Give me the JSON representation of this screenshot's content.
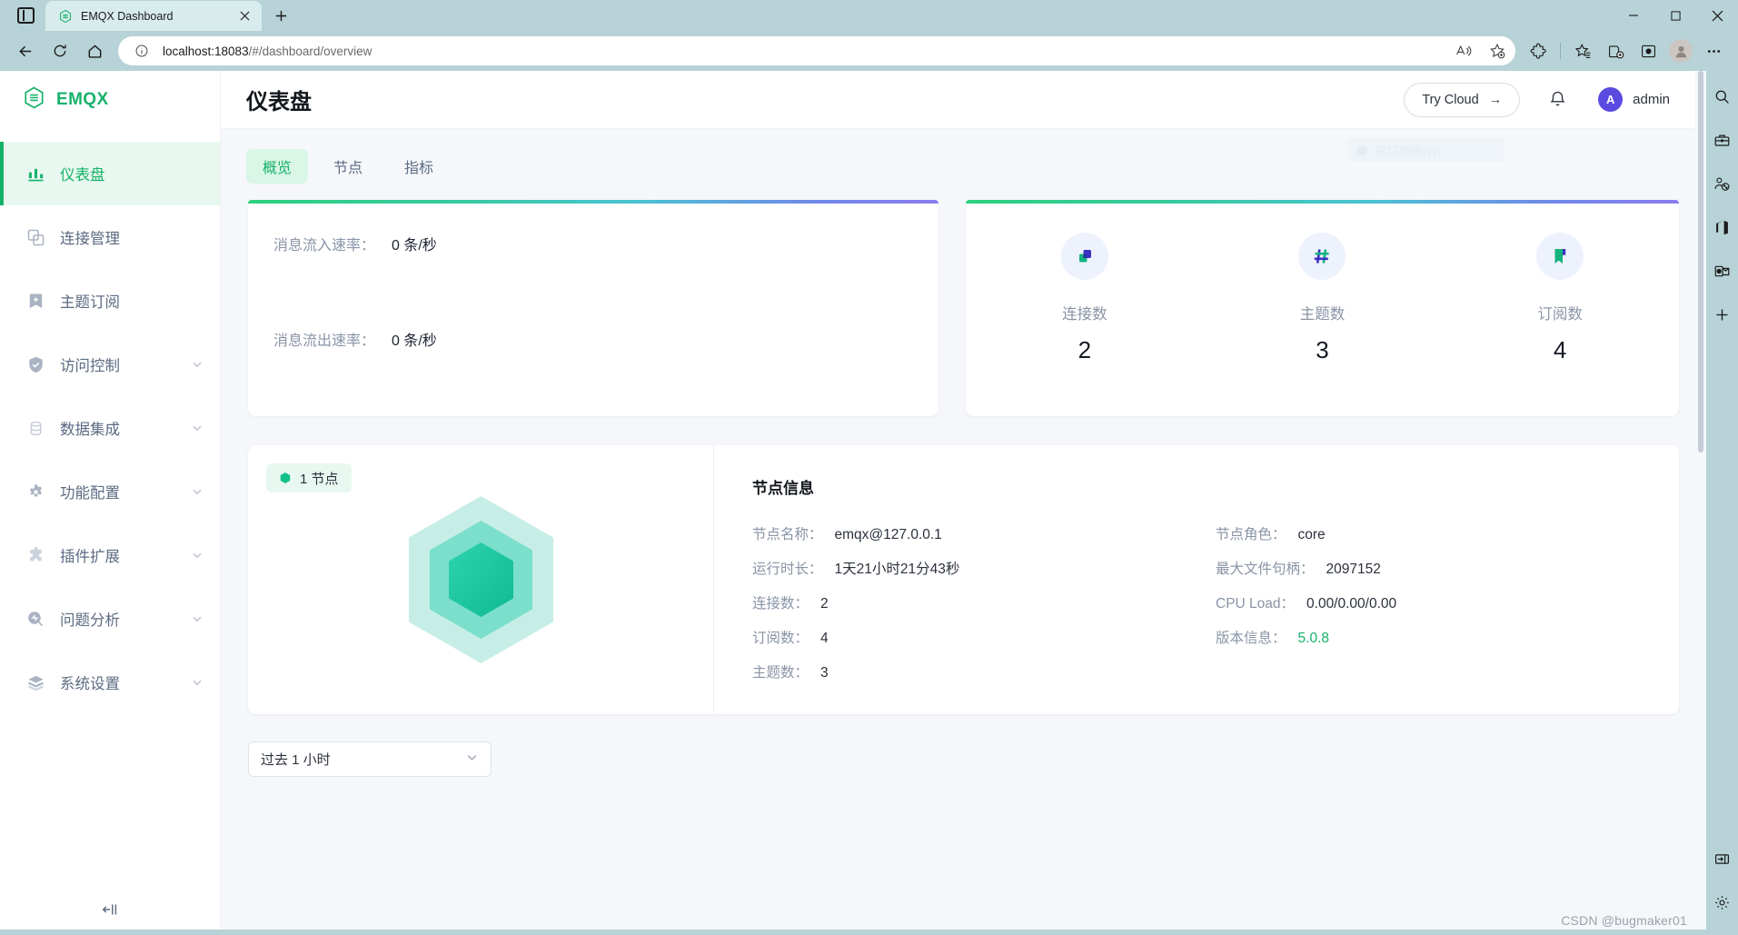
{
  "browser": {
    "tab": {
      "title": "EMQX Dashboard",
      "favicon_icon": "emqx-hexagon-icon",
      "close_icon": "close-icon"
    },
    "new_tab_icon": "plus-icon",
    "window_controls": {
      "minimize": "—",
      "maximize": "❐",
      "close": "✕"
    },
    "nav": {
      "back_icon": "arrow-left-icon",
      "reload_icon": "reload-icon",
      "home_icon": "home-icon"
    },
    "omnibox": {
      "info_icon": "info-circle-icon",
      "url_host": "localhost:18083",
      "url_path": "/#/dashboard/overview",
      "read_aloud_icon": "read-aloud-icon",
      "favorite_icon": "add-favorite-icon"
    },
    "toolbar_icons": [
      "extensions-icon",
      "favorites-icon",
      "collections-icon",
      "browser-essentials-icon",
      "profile-avatar-icon",
      "settings-more-icon"
    ]
  },
  "sidebar": {
    "logo": {
      "text": "EMQX",
      "icon": "emqx-hexagon-icon"
    },
    "items": [
      {
        "label": "仪表盘",
        "icon": "dashboard-chart-icon",
        "active": true,
        "expandable": false
      },
      {
        "label": "连接管理",
        "icon": "connections-icon",
        "active": false,
        "expandable": false
      },
      {
        "label": "主题订阅",
        "icon": "topic-bookmark-icon",
        "active": false,
        "expandable": false
      },
      {
        "label": "访问控制",
        "icon": "shield-icon",
        "active": false,
        "expandable": true
      },
      {
        "label": "数据集成",
        "icon": "database-icon",
        "active": false,
        "expandable": true
      },
      {
        "label": "功能配置",
        "icon": "gear-icon",
        "active": false,
        "expandable": true
      },
      {
        "label": "插件扩展",
        "icon": "puzzle-icon",
        "active": false,
        "expandable": true
      },
      {
        "label": "问题分析",
        "icon": "diagnose-magnifier-icon",
        "active": false,
        "expandable": true
      },
      {
        "label": "系统设置",
        "icon": "layers-icon",
        "active": false,
        "expandable": true
      }
    ],
    "collapse_icon": "collapse-sidebar-icon"
  },
  "topbar": {
    "title": "仪表盘",
    "try_cloud_label": "Try Cloud",
    "try_cloud_arrow": "→",
    "bell_icon": "notification-bell-icon",
    "user": {
      "initial": "A",
      "name": "admin"
    }
  },
  "tabs": [
    {
      "label": "概览",
      "selected": true
    },
    {
      "label": "节点",
      "selected": false
    },
    {
      "label": "指标",
      "selected": false
    }
  ],
  "ghost_overlay": {
    "text": "窗口截图(W)"
  },
  "rate_card": {
    "rows": [
      {
        "label": "消息流入速率：",
        "value": "0 条/秒"
      },
      {
        "label": "消息流出速率：",
        "value": "0 条/秒"
      }
    ]
  },
  "stats_card": {
    "stats": [
      {
        "icon": "connections-stat-icon",
        "label": "连接数",
        "value": "2"
      },
      {
        "icon": "hash-topics-icon",
        "label": "主题数",
        "value": "3"
      },
      {
        "icon": "subscription-bookmark-icon",
        "label": "订阅数",
        "value": "4"
      }
    ]
  },
  "node_card": {
    "badge": {
      "text": "1 节点",
      "icon": "hexagon-dot-icon"
    },
    "title": "节点信息",
    "left_column": [
      {
        "label": "节点名称：",
        "value": "emqx@127.0.0.1"
      },
      {
        "label": "运行时长：",
        "value": "1天21小时21分43秒"
      },
      {
        "label": "连接数：",
        "value": "2"
      },
      {
        "label": "订阅数：",
        "value": "4"
      },
      {
        "label": "主题数：",
        "value": "3"
      }
    ],
    "right_column": [
      {
        "label": "节点角色：",
        "value": "core",
        "accent": false
      },
      {
        "label": "最大文件句柄：",
        "value": "2097152",
        "accent": false
      },
      {
        "label": "CPU Load：",
        "value": "0.00/0.00/0.00",
        "accent": false
      },
      {
        "label": "版本信息：",
        "value": "5.0.8",
        "accent": true
      }
    ]
  },
  "range_select": {
    "value": "过去 1 小时",
    "chevron_icon": "chevron-down-icon"
  },
  "right_rail": {
    "icons": [
      "search-icon",
      "toolbox-icon",
      "game-assist-icon",
      "office-icon",
      "outlook-icon",
      "add-icon"
    ],
    "bottom_icons": [
      "split-screen-icon",
      "settings-gear-icon"
    ]
  },
  "watermark": "CSDN @bugmaker01",
  "colors": {
    "brand_green": "#17b26a",
    "accent_purple": "#5b4ae0",
    "chrome_bg": "#b7d3d7",
    "card_bg": "#ffffff",
    "page_bg": "#f5f7fa"
  }
}
